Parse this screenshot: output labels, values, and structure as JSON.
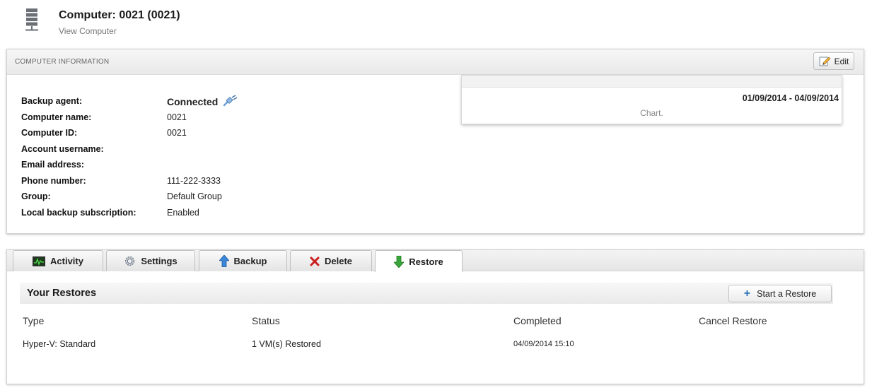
{
  "header": {
    "title": "Computer: 0021 (0021)",
    "subtitle": "View Computer"
  },
  "info_panel": {
    "heading": "COMPUTER INFORMATION",
    "edit_label": "Edit",
    "rows": [
      {
        "label": "Backup agent:",
        "value": "Connected"
      },
      {
        "label": "Computer name:",
        "value": "0021"
      },
      {
        "label": "Computer ID:",
        "value": "0021"
      },
      {
        "label": "Account username:",
        "value": ""
      },
      {
        "label": "Email address:",
        "value": ""
      },
      {
        "label": "Phone number:",
        "value": "111-222-3333"
      },
      {
        "label": "Group:",
        "value": "Default Group"
      },
      {
        "label": "Local backup subscription:",
        "value": "Enabled"
      }
    ],
    "chart": {
      "date_range": "01/09/2014 - 04/09/2014",
      "placeholder": "Chart."
    }
  },
  "tabs": [
    {
      "label": "Activity",
      "icon": "activity-monitor-icon"
    },
    {
      "label": "Settings",
      "icon": "gear-icon"
    },
    {
      "label": "Backup",
      "icon": "up-arrow-icon"
    },
    {
      "label": "Delete",
      "icon": "red-x-icon"
    },
    {
      "label": "Restore",
      "icon": "down-arrow-icon",
      "active": true
    }
  ],
  "restores": {
    "title": "Your Restores",
    "start_label": "Start a Restore",
    "columns": [
      "Type",
      "Status",
      "Completed",
      "Cancel Restore"
    ],
    "rows": [
      {
        "type": "Hyper-V: Standard",
        "status": "1 VM(s) Restored",
        "completed": "04/09/2014 15:10",
        "cancel": ""
      }
    ]
  },
  "colors": {
    "accent_blue": "#2a6fb5",
    "delete_red": "#cc1f1f",
    "restore_green": "#3aa53a",
    "panel_border": "#d2d2d2"
  }
}
